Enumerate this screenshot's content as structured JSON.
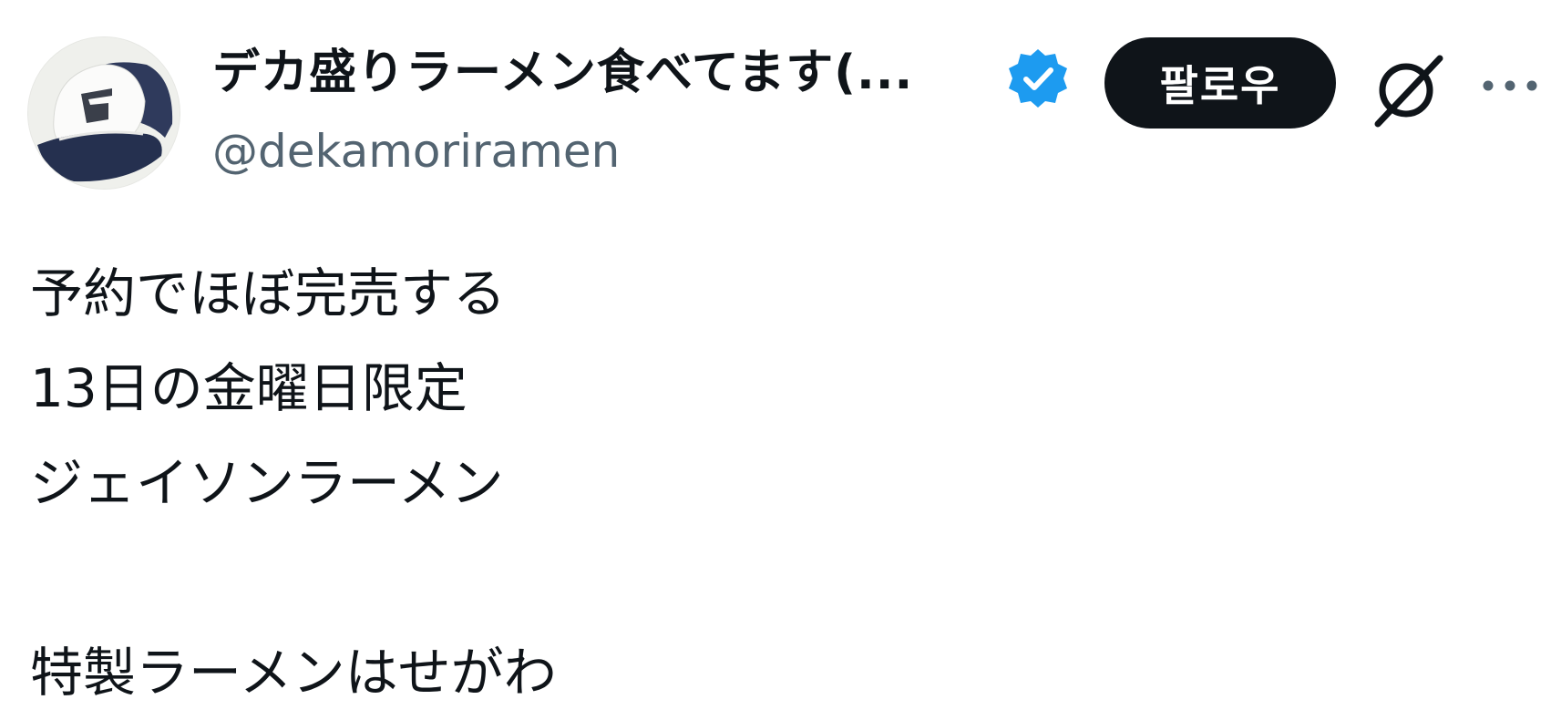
{
  "profile": {
    "display_name": "デカ盛りラーメン食べてます(...",
    "handle": "@dekamoriramen",
    "verified_color": "#1d9bf0"
  },
  "actions": {
    "follow_label": "팔로우",
    "grok_icon": "grok-icon",
    "more_icon": "more-icon"
  },
  "tweet": {
    "lines": [
      "予約でほぼ完売する",
      "13日の金曜日限定",
      "ジェイソンラーメン",
      "",
      "特製ラーメンはせがわ"
    ]
  }
}
